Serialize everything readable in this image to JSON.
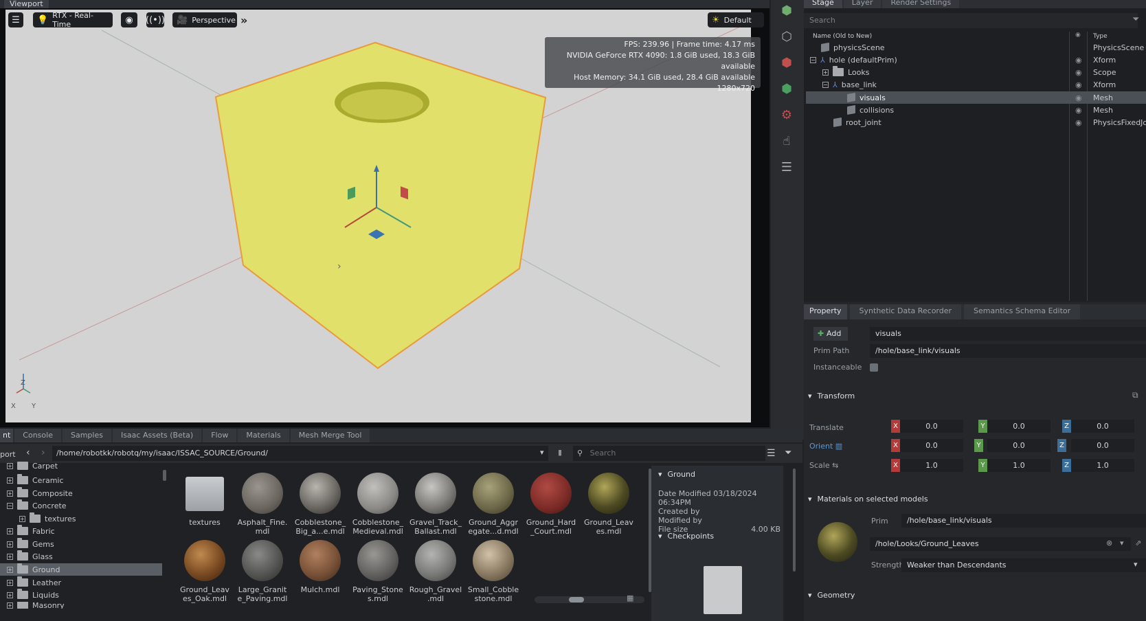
{
  "viewport": {
    "title": "Viewport",
    "toolbar": {
      "render_mode": "RTX - Real-Time",
      "camera": "Perspective",
      "lighting": "Default"
    },
    "stats": [
      "FPS: 239.96 | Frame time: 4.17 ms",
      "NVIDIA GeForce RTX 4090: 1.8 GiB used, 18.3 GiB available",
      "Host Memory: 34.1 GiB used, 28.4 GiB available",
      "1280x720"
    ],
    "axis_labels": {
      "z": "Z",
      "x": "X",
      "y": "Y"
    }
  },
  "stage": {
    "tabs": [
      "Stage",
      "Layer",
      "Render Settings"
    ],
    "search_placeholder": "Search",
    "header": {
      "name": "Name (Old to New)",
      "type": "Type"
    },
    "rows": [
      {
        "name": "physicsScene",
        "type": "PhysicsScene"
      },
      {
        "name": "hole (defaultPrim)",
        "type": "Xform"
      },
      {
        "name": "Looks",
        "type": "Scope"
      },
      {
        "name": "base_link",
        "type": "Xform"
      },
      {
        "name": "visuals",
        "type": "Mesh"
      },
      {
        "name": "collisions",
        "type": "Mesh"
      },
      {
        "name": "root_joint",
        "type": "PhysicsFixedJoi"
      }
    ]
  },
  "property": {
    "tabs": [
      "Property",
      "Synthetic Data Recorder",
      "Semantics Schema Editor"
    ],
    "add_label": "Add",
    "name_value": "visuals",
    "prim_path_label": "Prim Path",
    "prim_path_value": "/hole/base_link/visuals",
    "instanceable_label": "Instanceable",
    "transform": {
      "section": "Transform",
      "translate_label": "Translate",
      "orient_label": "Orient",
      "scale_label": "Scale",
      "translate": [
        "0.0",
        "0.0",
        "0.0"
      ],
      "orient": [
        "0.0",
        "0.0",
        "0.0"
      ],
      "scale": [
        "1.0",
        "1.0",
        "1.0"
      ],
      "axes": [
        "X",
        "Y",
        "Z"
      ]
    },
    "materials": {
      "section": "Materials on selected models",
      "prim_label": "Prim",
      "prim_value": "/hole/base_link/visuals",
      "material_value": "/hole/Looks/Ground_Leaves",
      "strength_label": "Strength",
      "strength_value": "Weaker than Descendants"
    },
    "geometry_section": "Geometry"
  },
  "bottom": {
    "tabs": [
      "nt",
      "Console",
      "Samples",
      "Isaac Assets (Beta)",
      "Flow",
      "Materials",
      "Mesh Merge Tool"
    ],
    "left_label": "port",
    "path": "/home/robotkk/robotq/my/isaac/ISSAC_SOURCE/Ground/",
    "search_placeholder": "Search",
    "folders": [
      "Carpet",
      "Ceramic",
      "Composite",
      "Concrete",
      "textures",
      "Fabric",
      "Gems",
      "Glass",
      "Ground",
      "Leather",
      "Liquids",
      "Masonry"
    ],
    "assets_row1": [
      "textures",
      "Asphalt_Fine.\nmdl",
      "Cobblestone_\nBig_a...e.mdl",
      "Cobblestone_\nMedieval.mdl",
      "Gravel_Track_\nBallast.mdl",
      "Ground_Aggr\negate...d.mdl",
      "Ground_Hard\n_Court.mdl",
      "Ground_Leav\nes.mdl"
    ],
    "assets_row2": [
      "Ground_Leav\nes_Oak.mdl",
      "Large_Granit\ne_Paving.mdl",
      "Mulch.mdl",
      "Paving_Stone\ns.mdl",
      "Rough_Gravel\n.mdl",
      "Small_Cobble\nstone.mdl"
    ],
    "details": {
      "title": "Ground",
      "date_modified": "Date Modified 03/18/2024 06:34PM",
      "created_by": "Created by",
      "modified_by": "Modified by",
      "file_size_label": "File size",
      "file_size_value": "4.00 KB",
      "checkpoints": "Checkpoints"
    }
  }
}
